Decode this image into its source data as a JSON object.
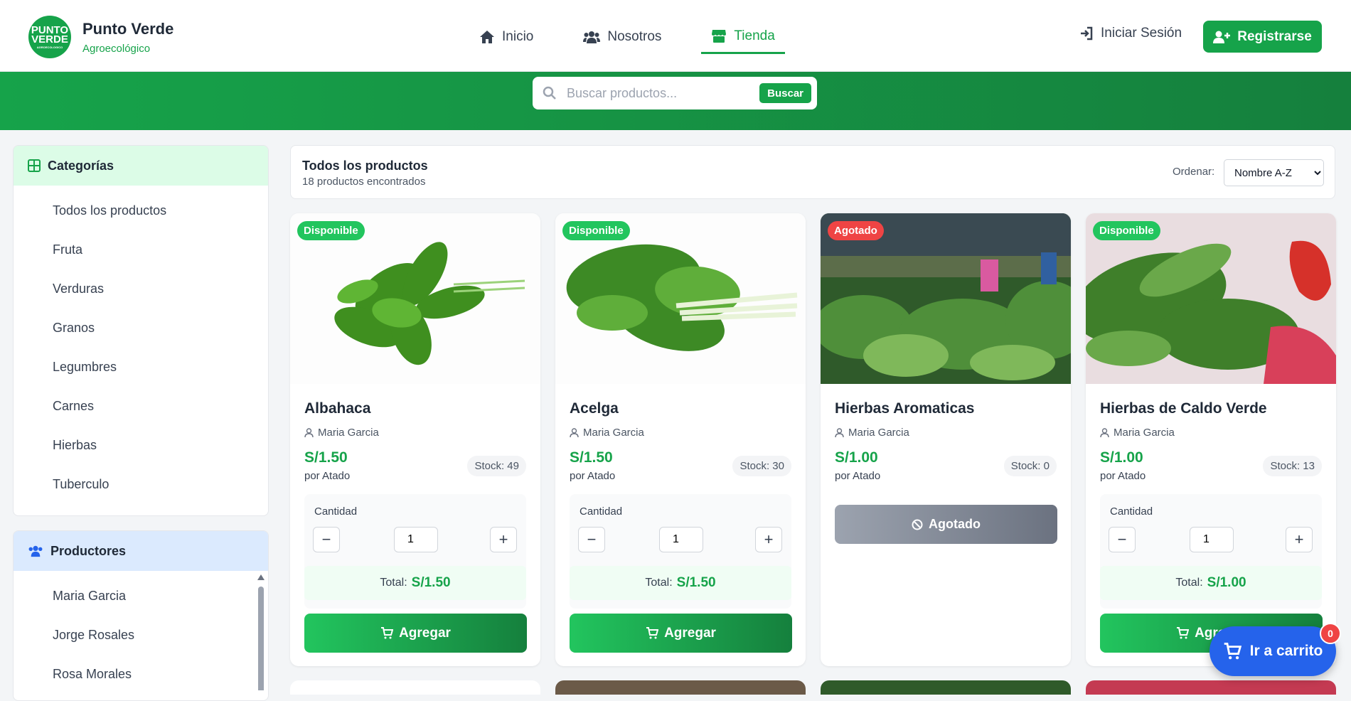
{
  "brand": {
    "name": "Punto Verde",
    "subtitle": "Agroecológico",
    "logo_text": "PUNTO VERDE"
  },
  "nav": [
    {
      "label": "Inicio",
      "icon": "home-icon"
    },
    {
      "label": "Nosotros",
      "icon": "users-icon"
    },
    {
      "label": "Tienda",
      "icon": "store-icon",
      "active": true
    }
  ],
  "auth": {
    "login": "Iniciar Sesión",
    "register": "Registrarse"
  },
  "search": {
    "placeholder": "Buscar productos...",
    "button": "Buscar"
  },
  "categories": {
    "title": "Categorías",
    "items": [
      "Todos los productos",
      "Fruta",
      "Verduras",
      "Granos",
      "Legumbres",
      "Carnes",
      "Hierbas",
      "Tuberculo"
    ]
  },
  "producers": {
    "title": "Productores",
    "items": [
      "Maria Garcia",
      "Jorge Rosales",
      "Rosa Morales"
    ]
  },
  "toolbar": {
    "title": "Todos los productos",
    "count": "18 productos encontrados",
    "sort_label": "Ordenar:",
    "sort_value": "Nombre A-Z"
  },
  "products": [
    {
      "badge": "Disponible",
      "name": "Albahaca",
      "seller": "Maria Garcia",
      "price": "S/1.50",
      "unit": "por Atado",
      "stock": "Stock: 49",
      "qty_label": "Cantidad",
      "qty": "1",
      "total_label": "Total:",
      "total": "S/1.50",
      "button": "Agregar"
    },
    {
      "badge": "Disponible",
      "name": "Acelga",
      "seller": "Maria Garcia",
      "price": "S/1.50",
      "unit": "por Atado",
      "stock": "Stock: 30",
      "qty_label": "Cantidad",
      "qty": "1",
      "total_label": "Total:",
      "total": "S/1.50",
      "button": "Agregar"
    },
    {
      "badge": "Agotado",
      "name": "Hierbas Aromaticas",
      "seller": "Maria Garcia",
      "price": "S/1.00",
      "unit": "por Atado",
      "stock": "Stock: 0",
      "button": "Agotado"
    },
    {
      "badge": "Disponible",
      "name": "Hierbas de Caldo Verde",
      "seller": "Maria Garcia",
      "price": "S/1.00",
      "unit": "por Atado",
      "stock": "Stock: 13",
      "qty_label": "Cantidad",
      "qty": "1",
      "total_label": "Total:",
      "total": "S/1.00",
      "button": "Agregar"
    }
  ],
  "cart": {
    "label": "Ir a carrito",
    "count": "0"
  },
  "colors": {
    "brand": "#16a34a",
    "available": "#22c55e",
    "soldout": "#ef4444",
    "cart": "#2563eb"
  }
}
